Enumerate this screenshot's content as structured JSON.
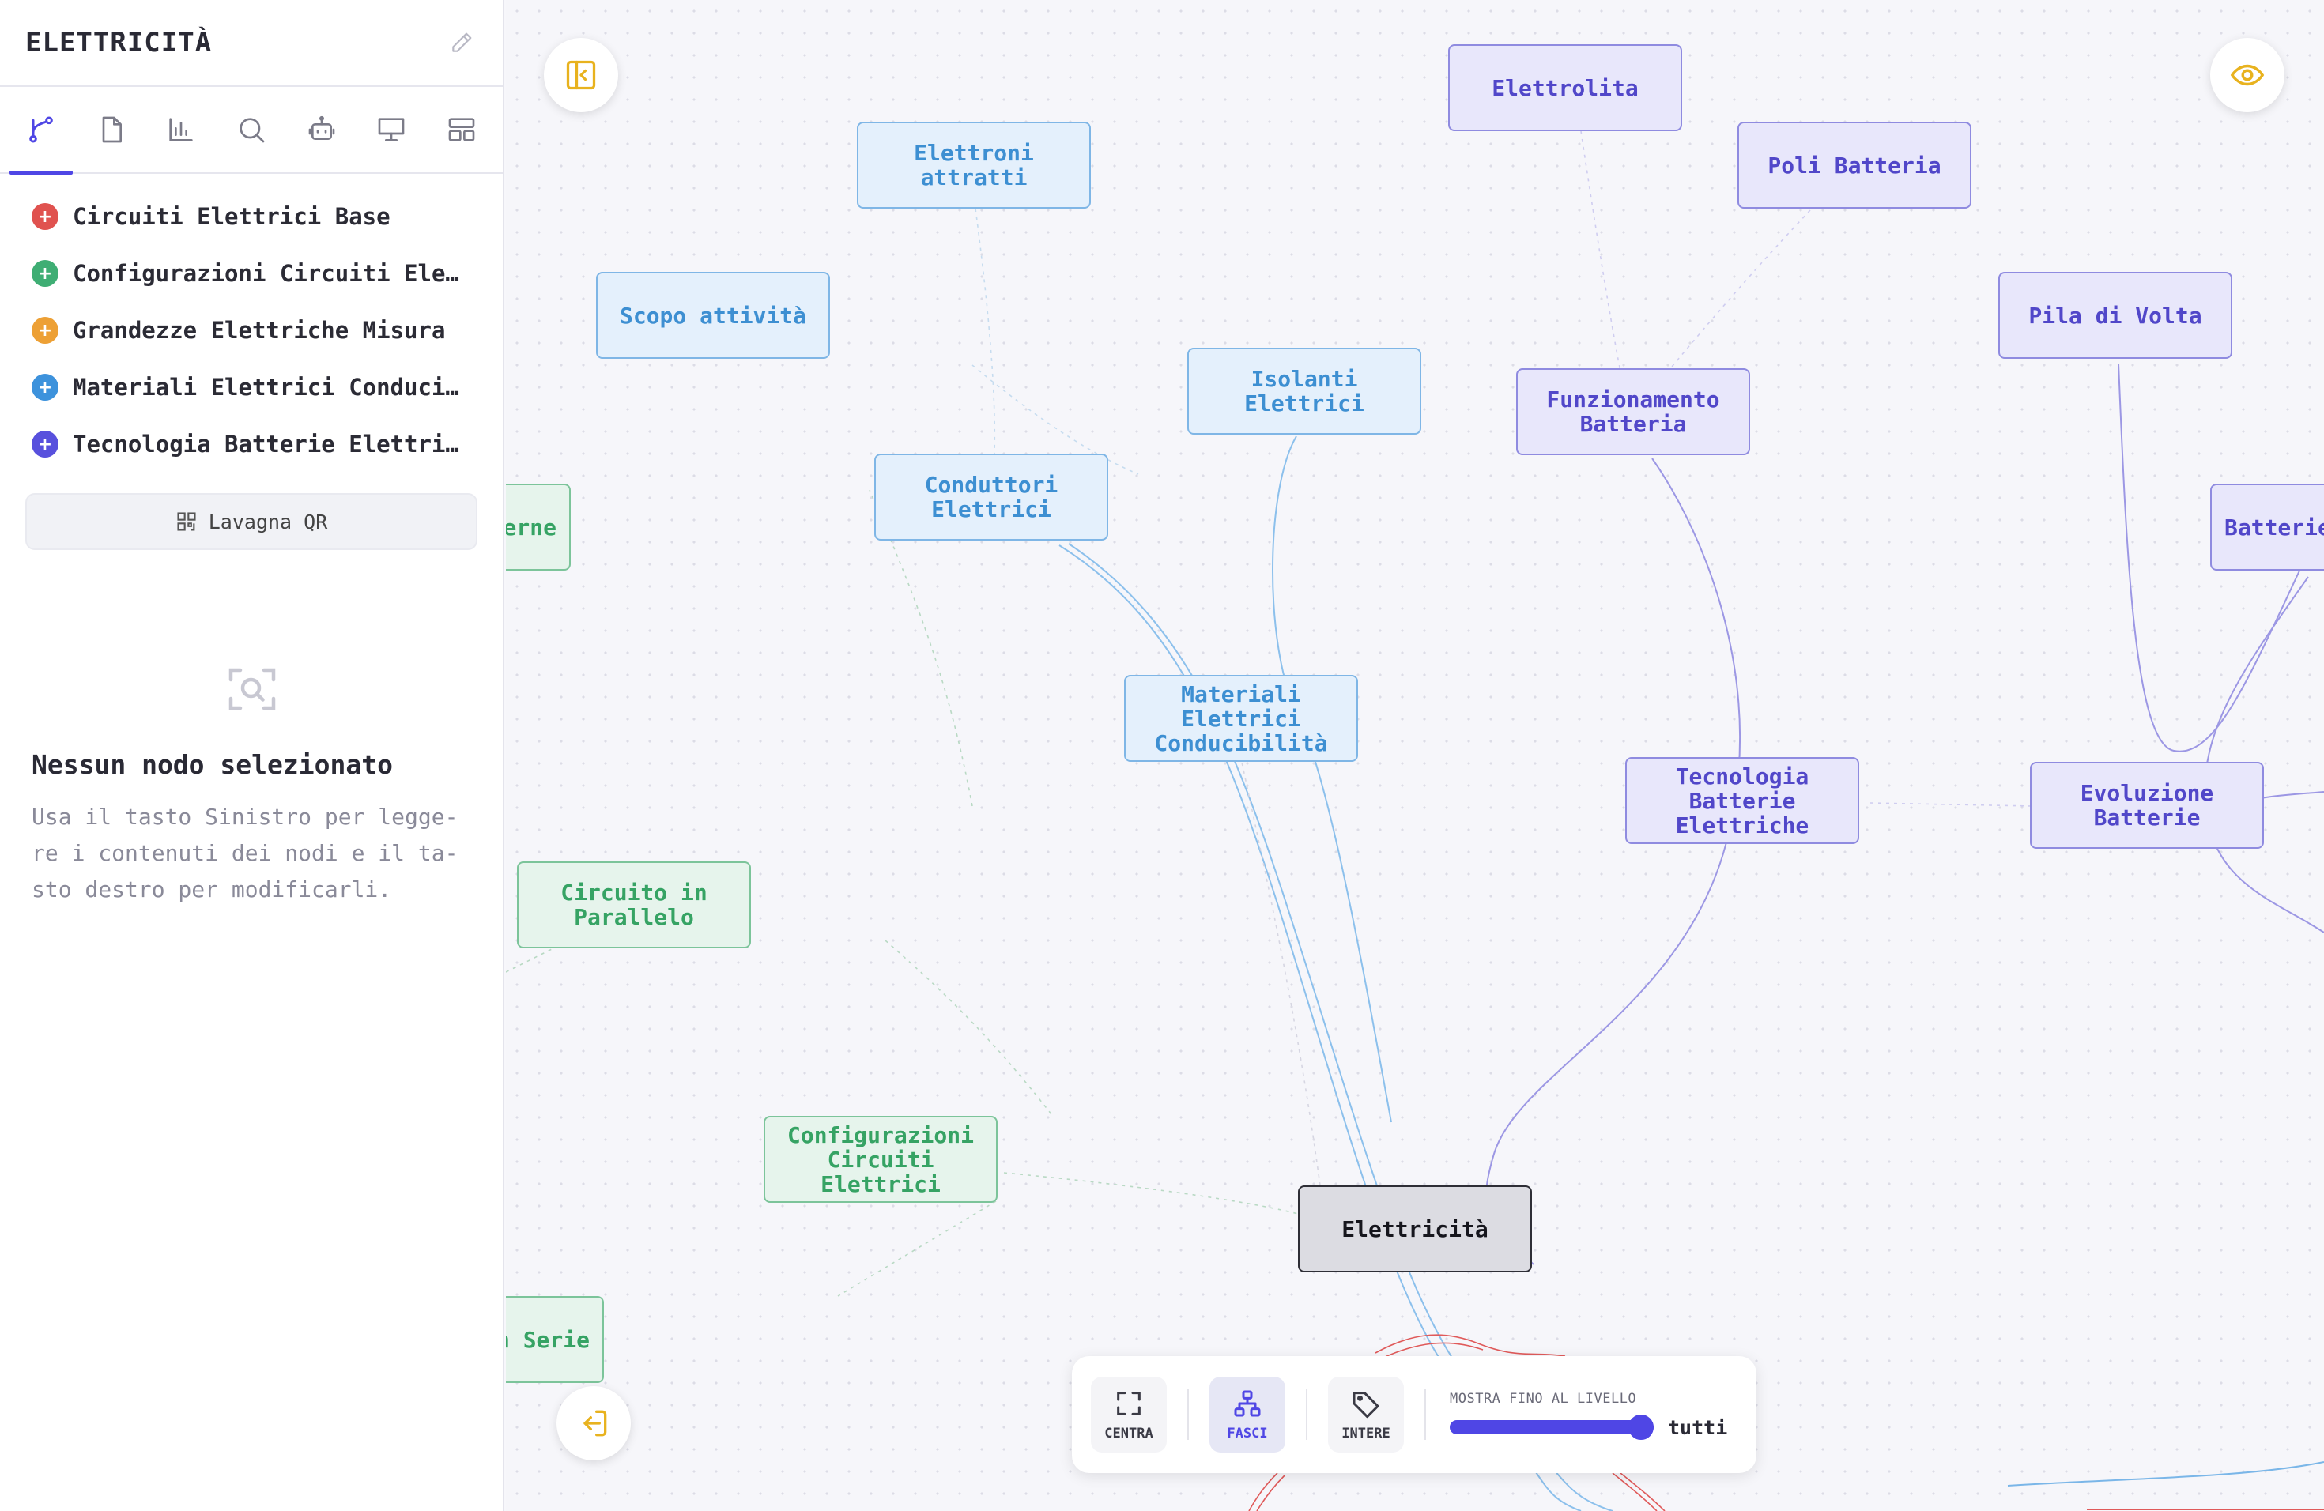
{
  "sidebar": {
    "title": "ELETTRICITÀ",
    "tabs": [
      {
        "name": "map-tab",
        "icon": "branch-icon",
        "active": true
      },
      {
        "name": "document-tab",
        "icon": "document-icon",
        "active": false
      },
      {
        "name": "stats-tab",
        "icon": "bar-chart-icon",
        "active": false
      },
      {
        "name": "search-tab",
        "icon": "search-icon",
        "active": false
      },
      {
        "name": "bot-tab",
        "icon": "robot-icon",
        "active": false
      },
      {
        "name": "presentation-tab",
        "icon": "presentation-icon",
        "active": false
      },
      {
        "name": "layout-tab",
        "icon": "layout-icon",
        "active": false
      }
    ],
    "topics": [
      {
        "label": "Circuiti Elettrici Base",
        "color": "#e0524f"
      },
      {
        "label": "Configurazioni Circuiti Elettrici",
        "color": "#3fae74"
      },
      {
        "label": "Grandezze Elettriche Misura",
        "color": "#eda035"
      },
      {
        "label": "Materiali Elettrici Conducibilità",
        "color": "#3d92dc"
      },
      {
        "label": "Tecnologia Batterie Elettriche",
        "color": "#5850dd"
      }
    ],
    "topic_marker": "+",
    "qr_label": "Lavagna QR",
    "empty_title": "Nessun nodo selezionato",
    "empty_desc": "Usa il tasto Sinistro per legge-re i contenuti dei nodi e il ta-sto destro per modificarli."
  },
  "colors": {
    "accent": "#4f46e5",
    "fab_icon": "#e8b21e",
    "blue_node": "#3d8fd2",
    "purple_node": "#5147c9",
    "green_node": "#36a364",
    "red_edge": "#e05a5a"
  },
  "nodes": [
    {
      "id": "elettrolita",
      "label": "Elettrolita",
      "kind": "purple"
    },
    {
      "id": "elettroni-attratti",
      "label": "Elettroni\nattratti",
      "kind": "blue"
    },
    {
      "id": "poli-batteria",
      "label": "Poli Batteria",
      "kind": "purple"
    },
    {
      "id": "scopo-attivita",
      "label": "Scopo attività",
      "kind": "blue"
    },
    {
      "id": "pila-di-volta",
      "label": "Pila di Volta",
      "kind": "purple"
    },
    {
      "id": "isolanti-elettrici",
      "label": "Isolanti\nElettrici",
      "kind": "blue"
    },
    {
      "id": "funzionamento-batteria",
      "label": "Funzionamento\nBatteria",
      "kind": "purple"
    },
    {
      "id": "conduttori-elettrici",
      "label": "Conduttori\nElettrici",
      "kind": "blue"
    },
    {
      "id": "moderne",
      "label": "moderne",
      "kind": "green"
    },
    {
      "id": "batterie",
      "label": "Batterie",
      "kind": "purple"
    },
    {
      "id": "materiali-elettrici",
      "label": "Materiali\nElettrici\nConducibilità",
      "kind": "blue"
    },
    {
      "id": "tecnologia-batterie",
      "label": "Tecnologia\nBatterie\nElettriche",
      "kind": "purple"
    },
    {
      "id": "evoluzione-batterie",
      "label": "Evoluzione\nBatterie",
      "kind": "purple"
    },
    {
      "id": "circuito-parallelo",
      "label": "Circuito in\nParallelo",
      "kind": "green"
    },
    {
      "id": "configurazioni-circuiti",
      "label": "Configurazioni\nCircuiti\nElettrici",
      "kind": "green"
    },
    {
      "id": "elettricita",
      "label": "Elettricità",
      "kind": "center"
    },
    {
      "id": "circuito-serie",
      "label": "cuito in Serie",
      "kind": "green"
    }
  ],
  "toolbar": {
    "centra": "CENTRA",
    "fasci": "FASCI",
    "intere": "INTERE",
    "level_label": "MOSTRA FINO AL LIVELLO",
    "level_value": "tutti",
    "level_fraction": 1.0
  }
}
